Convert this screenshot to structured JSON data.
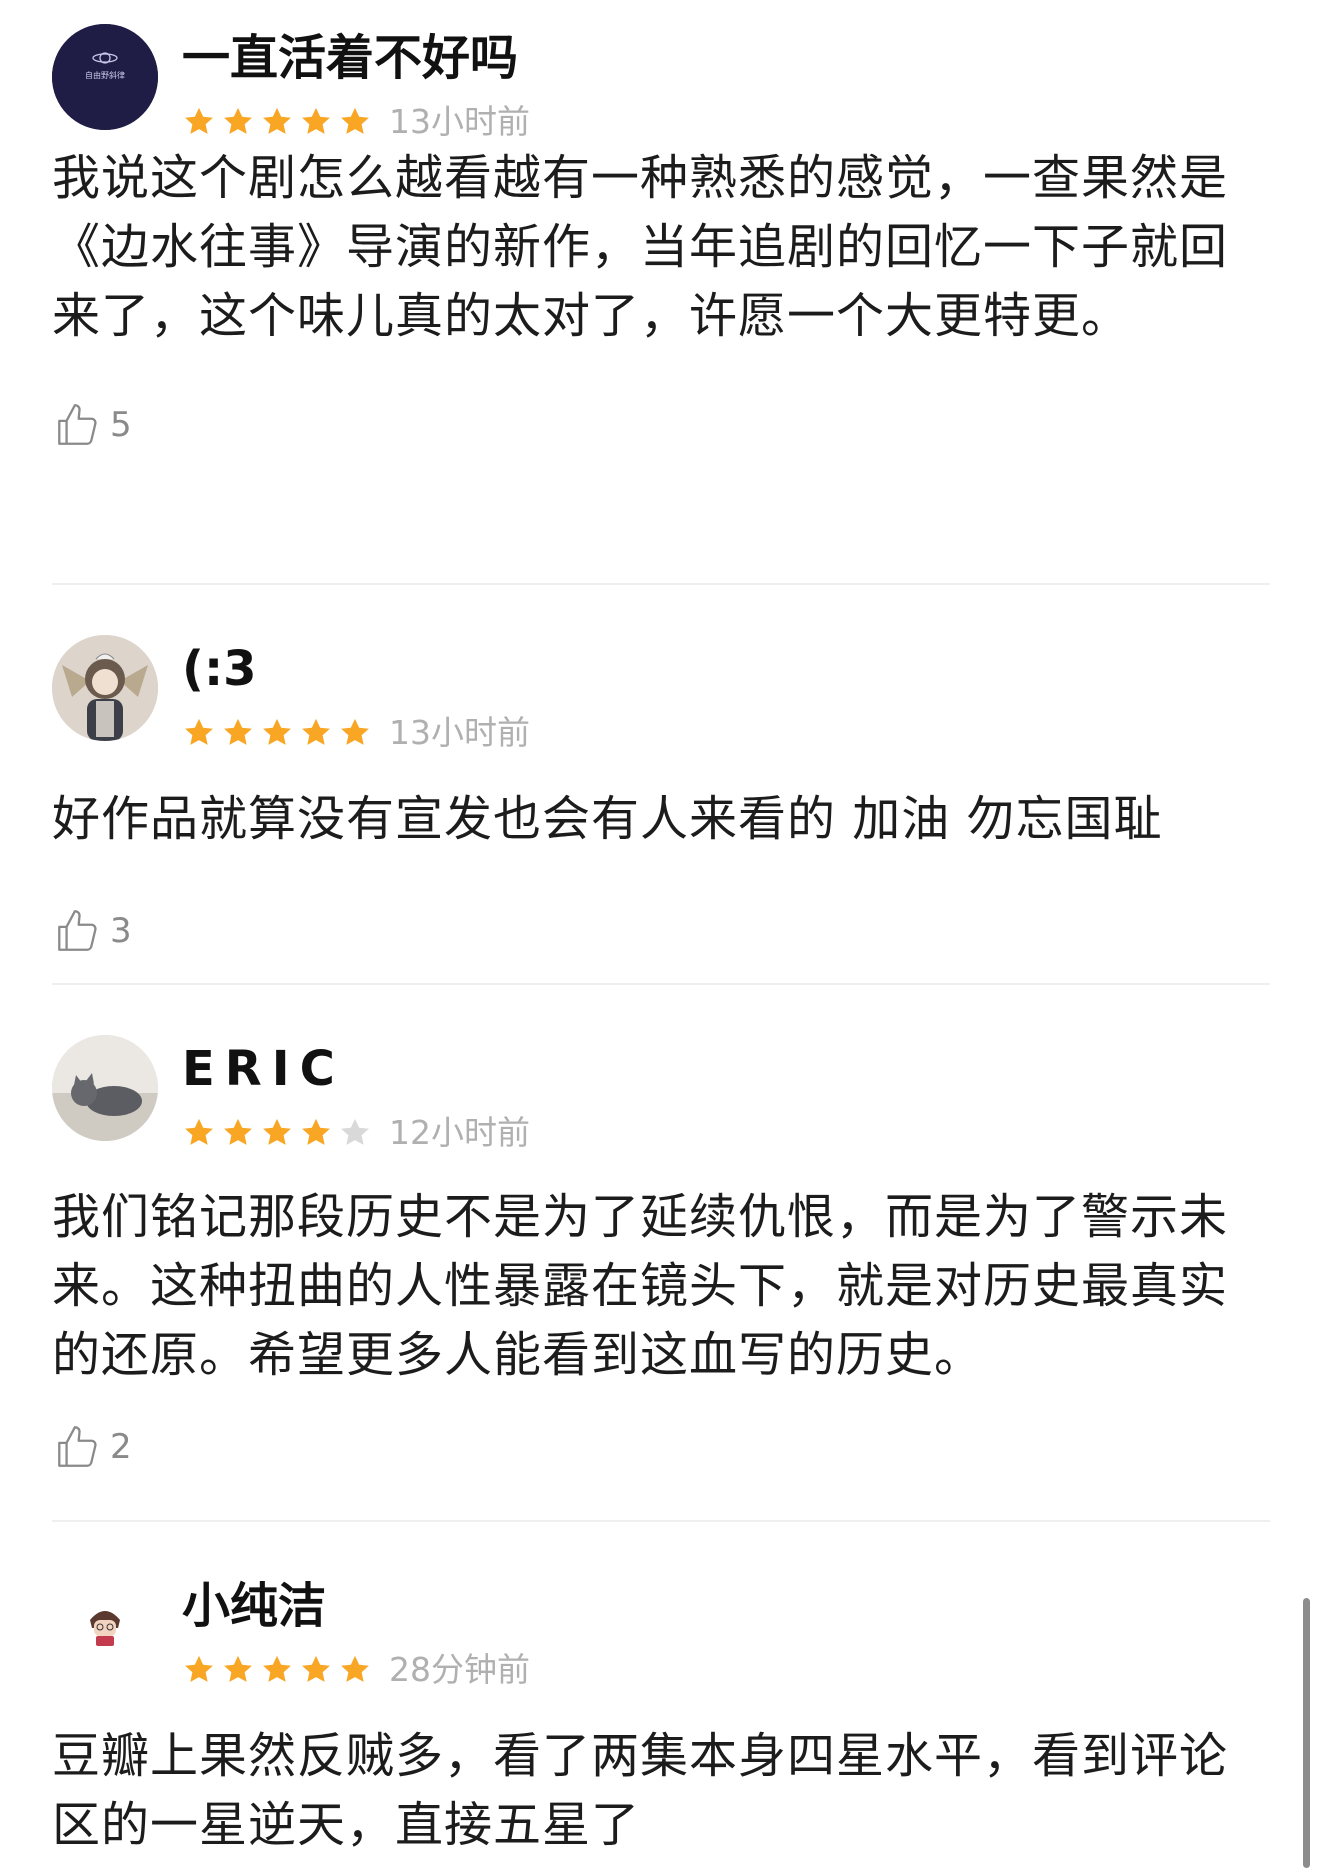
{
  "reviews": [
    {
      "username": "一直活着不好吗",
      "avatar_icon": "planet-logo-avatar",
      "avatar_text": "自由野斜律",
      "rating": 5,
      "max_rating": 5,
      "time": "13小时前",
      "content": "我说这个剧怎么越看越有一种熟悉的感觉，一查果然是《边水往事》导演的新作，当年追剧的回忆一下子就回来了，这个味儿真的太对了，许愿一个大更特更。",
      "likes": "5"
    },
    {
      "username": "(:3",
      "avatar_icon": "illustrated-girl-avatar",
      "rating": 5,
      "max_rating": 5,
      "time": "13小时前",
      "content": "好作品就算没有宣发也会有人来看的 加油 勿忘国耻",
      "likes": "3"
    },
    {
      "username": "ERIC",
      "avatar_icon": "grey-cat-avatar",
      "rating": 4,
      "max_rating": 5,
      "time": "12小时前",
      "content": "我们铭记那段历史不是为了延续仇恨，而是为了警示未来。这种扭曲的人性暴露在镜头下，就是对历史最真实的还原。希望更多人能看到这血写的历史。",
      "likes": "2"
    },
    {
      "username": "小纯洁",
      "avatar_icon": "anime-boy-avatar",
      "rating": 5,
      "max_rating": 5,
      "time": "28分钟前",
      "content": "豆瓣上果然反贼多，看了两集本身四星水平，看到评论区的一星逆天，直接五星了"
    }
  ],
  "colors": {
    "star_filled": "#F8A623",
    "star_empty": "#D9D9D9",
    "timestamp": "#B0B0B0",
    "divider": "#EFEFEF"
  },
  "icons": [
    "star-icon",
    "thumbs-up-icon"
  ]
}
